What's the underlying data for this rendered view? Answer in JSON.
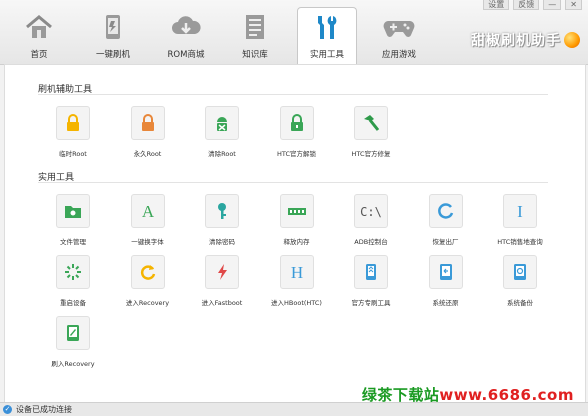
{
  "window": {
    "controls": [
      "设置",
      "反馈",
      "—",
      "✕"
    ]
  },
  "tabs": [
    {
      "label": "首页",
      "icon": "home-icon"
    },
    {
      "label": "一键刷机",
      "icon": "phone-flash-icon"
    },
    {
      "label": "ROM商城",
      "icon": "cloud-download-icon"
    },
    {
      "label": "知识库",
      "icon": "document-icon"
    },
    {
      "label": "实用工具",
      "icon": "tools-icon",
      "active": true
    },
    {
      "label": "应用游戏",
      "icon": "gamepad-icon"
    }
  ],
  "brand": "甜椒刷机助手",
  "sections": {
    "flash_tools": "刷机辅助工具",
    "utility_tools": "实用工具"
  },
  "flash_tools": [
    {
      "label": "临时Root",
      "icon": "lock-temp-icon",
      "color": "#f5b400"
    },
    {
      "label": "永久Root",
      "icon": "lock-permanent-icon",
      "color": "#e8873a"
    },
    {
      "label": "清除Root",
      "icon": "android-clear-icon",
      "color": "#3aa657"
    },
    {
      "label": "HTC官方解锁",
      "icon": "unlock-icon",
      "color": "#3aa657"
    },
    {
      "label": "HTC官方修复",
      "icon": "hammer-icon",
      "color": "#2e9a4a"
    }
  ],
  "utility_tools": [
    {
      "label": "文件管理",
      "icon": "folder-icon",
      "color": "#3aa657"
    },
    {
      "label": "一键换字体",
      "icon": "font-icon",
      "color": "#3aa657"
    },
    {
      "label": "清除密码",
      "icon": "key-icon",
      "color": "#2aa6a0"
    },
    {
      "label": "释放内存",
      "icon": "memory-icon",
      "color": "#3aa657"
    },
    {
      "label": "ADB控制台",
      "icon": "console-icon",
      "color": "#555555"
    },
    {
      "label": "恢复出厂",
      "icon": "restore-icon",
      "color": "#3a9ad8"
    },
    {
      "label": "HTC销售地查询",
      "icon": "info-icon",
      "color": "#3a9ad8"
    },
    {
      "label": "重启设备",
      "icon": "loading-icon",
      "color": "#3aa657"
    },
    {
      "label": "进入Recovery",
      "icon": "refresh-icon",
      "color": "#f5b400"
    },
    {
      "label": "进入Fastboot",
      "icon": "flash-icon",
      "color": "#e04848"
    },
    {
      "label": "进入HBoot(HTC)",
      "icon": "hboot-icon",
      "color": "#3a9ad8"
    },
    {
      "label": "官方专刷工具",
      "icon": "phone-tool-icon",
      "color": "#3a9ad8"
    },
    {
      "label": "系统还原",
      "icon": "system-restore-icon",
      "color": "#3a9ad8"
    },
    {
      "label": "系统备份",
      "icon": "system-backup-icon",
      "color": "#3a9ad8"
    },
    {
      "label": "刷入Recovery",
      "icon": "write-recovery-icon",
      "color": "#3aa657"
    }
  ],
  "status": {
    "text": "设备已成功连接"
  },
  "watermark": {
    "green": "绿茶下载站",
    "red": "www.6686.com"
  }
}
